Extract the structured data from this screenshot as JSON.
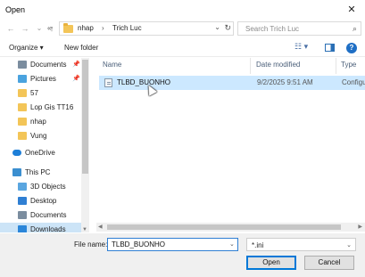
{
  "window": {
    "title": "Open",
    "close_glyph": "✕"
  },
  "address": {
    "back_glyph": "←",
    "forward_glyph": "→",
    "recent_glyph": "⌄",
    "up_glyph": "↑",
    "overflow": "«",
    "crumbs": [
      "nhap",
      "Trich Luc"
    ],
    "separator": "›",
    "dropdown_glyph": "⌄",
    "refresh_glyph": "↻",
    "search_placeholder": "Search Trich Luc",
    "search_glyph": "⌕"
  },
  "toolbar": {
    "organize": "Organize ▾",
    "new_folder": "New folder",
    "view_glyph": "☷ ▾",
    "help_glyph": "?"
  },
  "sidebar": {
    "items": [
      {
        "label": "Documents",
        "icon": "documents-icon",
        "pinned": true,
        "pin_glyph": "📌"
      },
      {
        "label": "Pictures",
        "icon": "pictures-icon",
        "pinned": true,
        "pin_glyph": "📌"
      },
      {
        "label": "57",
        "icon": "folder-icon"
      },
      {
        "label": "Lop Gis TT16",
        "icon": "folder-icon"
      },
      {
        "label": "nhap",
        "icon": "folder-icon"
      },
      {
        "label": "Vung",
        "icon": "folder-icon"
      },
      {
        "label": "OneDrive",
        "icon": "onedrive-icon"
      },
      {
        "label": "This PC",
        "icon": "this-pc-icon"
      },
      {
        "label": "3D Objects",
        "icon": "3d-objects-icon"
      },
      {
        "label": "Desktop",
        "icon": "desktop-icon"
      },
      {
        "label": "Documents",
        "icon": "documents-icon"
      },
      {
        "label": "Downloads",
        "icon": "downloads-icon",
        "selected": true
      }
    ],
    "expand_glyph": "›"
  },
  "filelist": {
    "columns": [
      "Name",
      "Date modified",
      "Type"
    ],
    "rows": [
      {
        "name": "TLBD_BUONHO",
        "date_modified": "9/2/2025 9:51 AM",
        "type": "Configu"
      }
    ]
  },
  "footer": {
    "file_name_label": "File name:",
    "file_name_value": "TLBD_BUONHO",
    "file_type_value": "*.ini",
    "dropdown_glyph": "⌄",
    "open_label": "Open",
    "cancel_label": "Cancel"
  }
}
